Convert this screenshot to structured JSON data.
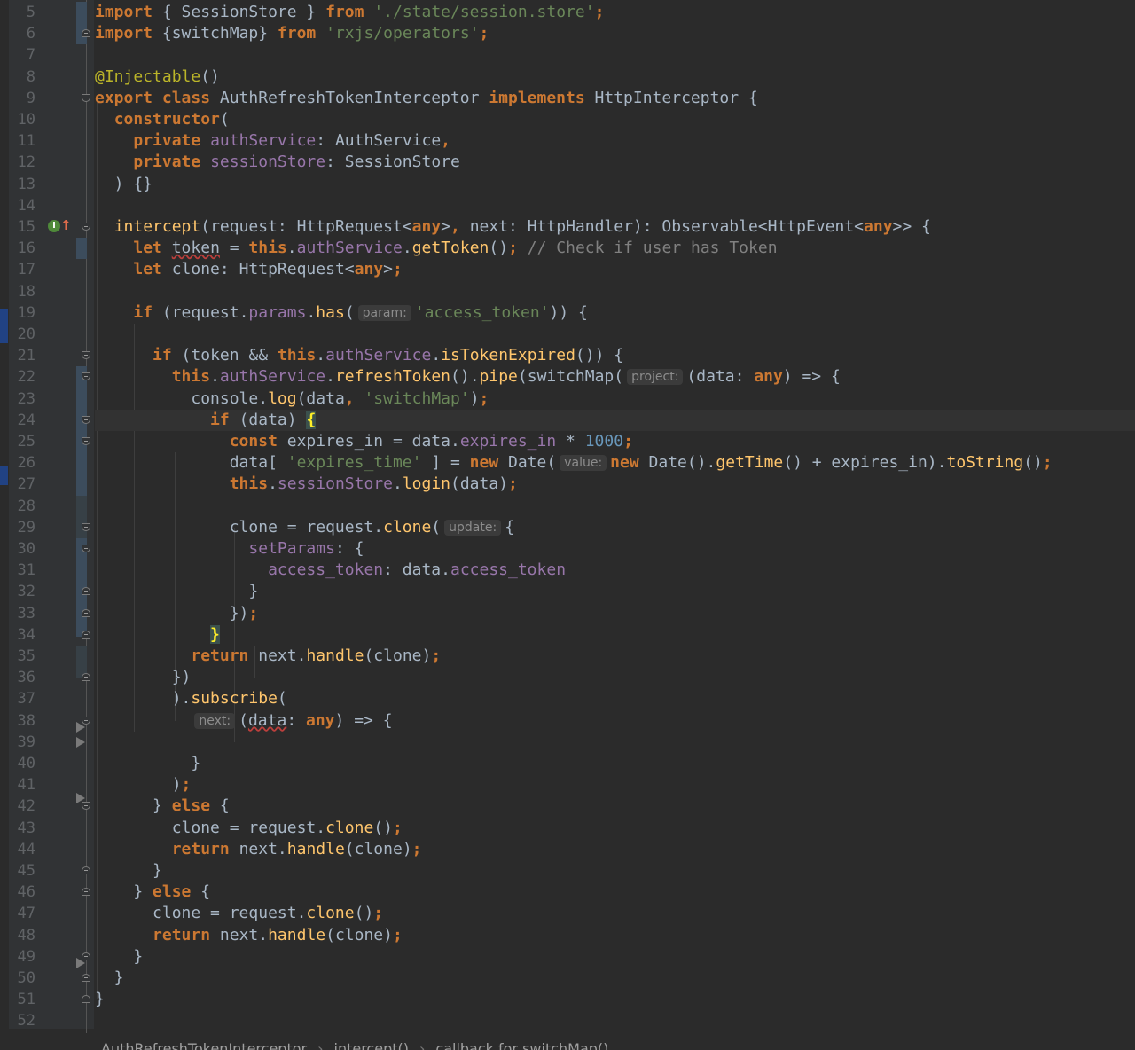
{
  "editor": {
    "language": "TypeScript",
    "current_line": 24,
    "theme_colors": {
      "background": "#2b2b2b",
      "gutter": "#313335",
      "keyword": "#cc7832",
      "string": "#6a8759",
      "number": "#6897bb",
      "field": "#9876aa",
      "function": "#ffc66d",
      "annotation": "#bbb529",
      "comment": "#808080",
      "default_text": "#a9b7c6"
    }
  },
  "lines": [
    {
      "n": "5",
      "tokens": [
        [
          "kw",
          "import"
        ],
        [
          "def",
          " { SessionStore } "
        ],
        [
          "kw",
          "from"
        ],
        [
          "def",
          " "
        ],
        [
          "str",
          "'./state/session.store'"
        ],
        [
          "kw",
          ";"
        ]
      ]
    },
    {
      "n": "6",
      "tokens": [
        [
          "kw",
          "import"
        ],
        [
          "def",
          " {switchMap} "
        ],
        [
          "kw",
          "from"
        ],
        [
          "def",
          " "
        ],
        [
          "str",
          "'rxjs/operators'"
        ],
        [
          "kw",
          ";"
        ]
      ]
    },
    {
      "n": "7",
      "tokens": []
    },
    {
      "n": "8",
      "tokens": [
        [
          "ann",
          "@Injectable"
        ],
        [
          "def",
          "()"
        ]
      ]
    },
    {
      "n": "9",
      "tokens": [
        [
          "kw",
          "export class"
        ],
        [
          "def",
          " AuthRefreshTokenInterceptor "
        ],
        [
          "kw",
          "implements"
        ],
        [
          "def",
          " HttpInterceptor {"
        ]
      ]
    },
    {
      "n": "10",
      "tokens": [
        [
          "def",
          "  "
        ],
        [
          "kw",
          "constructor"
        ],
        [
          "def",
          "("
        ]
      ]
    },
    {
      "n": "11",
      "tokens": [
        [
          "def",
          "    "
        ],
        [
          "kw",
          "private"
        ],
        [
          "def",
          " "
        ],
        [
          "fld",
          "authService"
        ],
        [
          "def",
          ": AuthService"
        ],
        [
          "kw",
          ","
        ]
      ]
    },
    {
      "n": "12",
      "tokens": [
        [
          "def",
          "    "
        ],
        [
          "kw",
          "private"
        ],
        [
          "def",
          " "
        ],
        [
          "fld",
          "sessionStore"
        ],
        [
          "def",
          ": SessionStore"
        ]
      ]
    },
    {
      "n": "13",
      "tokens": [
        [
          "def",
          "  ) {}"
        ]
      ]
    },
    {
      "n": "14",
      "tokens": []
    },
    {
      "n": "15",
      "tokens": [
        [
          "def",
          "  "
        ],
        [
          "fn",
          "intercept"
        ],
        [
          "def",
          "(request: HttpRequest<"
        ],
        [
          "kw",
          "any"
        ],
        [
          "def",
          ">"
        ],
        [
          "kw",
          ","
        ],
        [
          "def",
          " next: HttpHandler): Observable<HttpEvent<"
        ],
        [
          "kw",
          "any"
        ],
        [
          "def",
          ">> {"
        ]
      ]
    },
    {
      "n": "16",
      "tokens": [
        [
          "def",
          "    "
        ],
        [
          "kw",
          "let"
        ],
        [
          "def",
          " "
        ],
        [
          "squig",
          "token"
        ],
        [
          "def",
          " = "
        ],
        [
          "kw",
          "this"
        ],
        [
          "def",
          "."
        ],
        [
          "fld",
          "authService"
        ],
        [
          "def",
          "."
        ],
        [
          "fn",
          "getToken"
        ],
        [
          "def",
          "()"
        ],
        [
          "kw",
          ";"
        ],
        [
          "def",
          " "
        ],
        [
          "cmt",
          "// Check if user has Token"
        ]
      ]
    },
    {
      "n": "17",
      "tokens": [
        [
          "def",
          "    "
        ],
        [
          "kw",
          "let"
        ],
        [
          "def",
          " clone: HttpRequest<"
        ],
        [
          "kw",
          "any"
        ],
        [
          "def",
          ">"
        ],
        [
          "kw",
          ";"
        ]
      ]
    },
    {
      "n": "18",
      "tokens": []
    },
    {
      "n": "19",
      "tokens": [
        [
          "def",
          "    "
        ],
        [
          "kw",
          "if"
        ],
        [
          "def",
          " (request."
        ],
        [
          "fld",
          "params"
        ],
        [
          "def",
          "."
        ],
        [
          "fn",
          "has"
        ],
        [
          "def",
          "("
        ],
        [
          "hint",
          "param:"
        ],
        [
          "str",
          "'access_token'"
        ],
        [
          "def",
          ")) {"
        ]
      ]
    },
    {
      "n": "20",
      "tokens": []
    },
    {
      "n": "21",
      "tokens": [
        [
          "def",
          "      "
        ],
        [
          "kw",
          "if"
        ],
        [
          "def",
          " (token && "
        ],
        [
          "kw",
          "this"
        ],
        [
          "def",
          "."
        ],
        [
          "fld",
          "authService"
        ],
        [
          "def",
          "."
        ],
        [
          "fn",
          "isTokenExpired"
        ],
        [
          "def",
          "()) {"
        ]
      ]
    },
    {
      "n": "22",
      "tokens": [
        [
          "def",
          "        "
        ],
        [
          "kw",
          "this"
        ],
        [
          "def",
          "."
        ],
        [
          "fld",
          "authService"
        ],
        [
          "def",
          "."
        ],
        [
          "fn",
          "refreshToken"
        ],
        [
          "def",
          "()."
        ],
        [
          "fn",
          "pipe"
        ],
        [
          "def",
          "(switchMap("
        ],
        [
          "hint",
          "project:"
        ],
        [
          "def",
          "(data: "
        ],
        [
          "kw",
          "any"
        ],
        [
          "def",
          ") => {"
        ]
      ]
    },
    {
      "n": "23",
      "tokens": [
        [
          "def",
          "          console."
        ],
        [
          "fn",
          "log"
        ],
        [
          "def",
          "(data"
        ],
        [
          "kw",
          ","
        ],
        [
          "def",
          " "
        ],
        [
          "str",
          "'switchMap'"
        ],
        [
          "def",
          ")"
        ],
        [
          "kw",
          ";"
        ]
      ]
    },
    {
      "n": "24",
      "tokens": [
        [
          "def",
          "            "
        ],
        [
          "kw",
          "if"
        ],
        [
          "def",
          " (data) "
        ],
        [
          "brace",
          "{"
        ]
      ]
    },
    {
      "n": "25",
      "tokens": [
        [
          "def",
          "              "
        ],
        [
          "kw",
          "const"
        ],
        [
          "def",
          " expires_in = data."
        ],
        [
          "fld",
          "expires_in"
        ],
        [
          "def",
          " * "
        ],
        [
          "num",
          "1000"
        ],
        [
          "kw",
          ";"
        ]
      ]
    },
    {
      "n": "26",
      "tokens": [
        [
          "def",
          "              data[ "
        ],
        [
          "str",
          "'expires_time'"
        ],
        [
          "def",
          " ] = "
        ],
        [
          "kw",
          "new"
        ],
        [
          "def",
          " Date("
        ],
        [
          "hint",
          "value:"
        ],
        [
          "kw",
          "new"
        ],
        [
          "def",
          " Date()."
        ],
        [
          "fn",
          "getTime"
        ],
        [
          "def",
          "() + expires_in)."
        ],
        [
          "fn",
          "toString"
        ],
        [
          "def",
          "()"
        ],
        [
          "kw",
          ";"
        ]
      ]
    },
    {
      "n": "27",
      "tokens": [
        [
          "def",
          "              "
        ],
        [
          "kw",
          "this"
        ],
        [
          "def",
          "."
        ],
        [
          "fld",
          "sessionStore"
        ],
        [
          "def",
          "."
        ],
        [
          "fn",
          "login"
        ],
        [
          "def",
          "(data)"
        ],
        [
          "kw",
          ";"
        ]
      ]
    },
    {
      "n": "28",
      "tokens": []
    },
    {
      "n": "29",
      "tokens": [
        [
          "def",
          "              clone = request."
        ],
        [
          "fn",
          "clone"
        ],
        [
          "def",
          "("
        ],
        [
          "hint",
          "update:"
        ],
        [
          "def",
          "{"
        ]
      ]
    },
    {
      "n": "30",
      "tokens": [
        [
          "def",
          "                "
        ],
        [
          "fld",
          "setParams"
        ],
        [
          "def",
          ": {"
        ]
      ]
    },
    {
      "n": "31",
      "tokens": [
        [
          "def",
          "                  "
        ],
        [
          "fld",
          "access_token"
        ],
        [
          "def",
          ": data."
        ],
        [
          "fld",
          "access_token"
        ]
      ]
    },
    {
      "n": "32",
      "tokens": [
        [
          "def",
          "                }"
        ]
      ]
    },
    {
      "n": "33",
      "tokens": [
        [
          "def",
          "              })"
        ],
        [
          "kw",
          ";"
        ]
      ]
    },
    {
      "n": "34",
      "tokens": [
        [
          "def",
          "            "
        ],
        [
          "brace",
          "}"
        ]
      ]
    },
    {
      "n": "35",
      "tokens": [
        [
          "def",
          "          "
        ],
        [
          "kw",
          "return"
        ],
        [
          "def",
          " next."
        ],
        [
          "fn",
          "handle"
        ],
        [
          "def",
          "(clone)"
        ],
        [
          "kw",
          ";"
        ]
      ]
    },
    {
      "n": "36",
      "tokens": [
        [
          "def",
          "        })"
        ]
      ]
    },
    {
      "n": "37",
      "tokens": [
        [
          "def",
          "        )."
        ],
        [
          "fn",
          "subscribe"
        ],
        [
          "def",
          "("
        ]
      ]
    },
    {
      "n": "38",
      "tokens": [
        [
          "def",
          "          "
        ],
        [
          "hint",
          "next:"
        ],
        [
          "def",
          "("
        ],
        [
          "squig",
          "data"
        ],
        [
          "def",
          ": "
        ],
        [
          "kw",
          "any"
        ],
        [
          "def",
          ") => {"
        ]
      ]
    },
    {
      "n": "39",
      "tokens": []
    },
    {
      "n": "40",
      "tokens": [
        [
          "def",
          "          }"
        ]
      ]
    },
    {
      "n": "41",
      "tokens": [
        [
          "def",
          "        )"
        ],
        [
          "kw",
          ";"
        ]
      ]
    },
    {
      "n": "42",
      "tokens": [
        [
          "def",
          "      } "
        ],
        [
          "kw",
          "else"
        ],
        [
          "def",
          " {"
        ]
      ]
    },
    {
      "n": "43",
      "tokens": [
        [
          "def",
          "        clone = request."
        ],
        [
          "fn",
          "clone"
        ],
        [
          "def",
          "()"
        ],
        [
          "kw",
          ";"
        ]
      ]
    },
    {
      "n": "44",
      "tokens": [
        [
          "def",
          "        "
        ],
        [
          "kw",
          "return"
        ],
        [
          "def",
          " next."
        ],
        [
          "fn",
          "handle"
        ],
        [
          "def",
          "(clone)"
        ],
        [
          "kw",
          ";"
        ]
      ]
    },
    {
      "n": "45",
      "tokens": [
        [
          "def",
          "      }"
        ]
      ]
    },
    {
      "n": "46",
      "tokens": [
        [
          "def",
          "    } "
        ],
        [
          "kw",
          "else"
        ],
        [
          "def",
          " {"
        ]
      ]
    },
    {
      "n": "47",
      "tokens": [
        [
          "def",
          "      clone = request."
        ],
        [
          "fn",
          "clone"
        ],
        [
          "def",
          "()"
        ],
        [
          "kw",
          ";"
        ]
      ]
    },
    {
      "n": "48",
      "tokens": [
        [
          "def",
          "      "
        ],
        [
          "kw",
          "return"
        ],
        [
          "def",
          " next."
        ],
        [
          "fn",
          "handle"
        ],
        [
          "def",
          "(clone)"
        ],
        [
          "kw",
          ";"
        ]
      ]
    },
    {
      "n": "49",
      "tokens": [
        [
          "def",
          "    }"
        ]
      ]
    },
    {
      "n": "50",
      "tokens": [
        [
          "def",
          "  }"
        ]
      ]
    },
    {
      "n": "51",
      "tokens": [
        [
          "def",
          "}"
        ]
      ]
    },
    {
      "n": "52",
      "tokens": []
    }
  ],
  "gutter": {
    "implements_icon": "implements-method-icon",
    "implements_icon_glyph": "I",
    "implements_arrow_glyph": "↑"
  },
  "breadcrumb": {
    "items": [
      "AuthRefreshTokenInterceptor",
      "intercept()",
      "callback for switchMap()"
    ],
    "separator": "›"
  }
}
